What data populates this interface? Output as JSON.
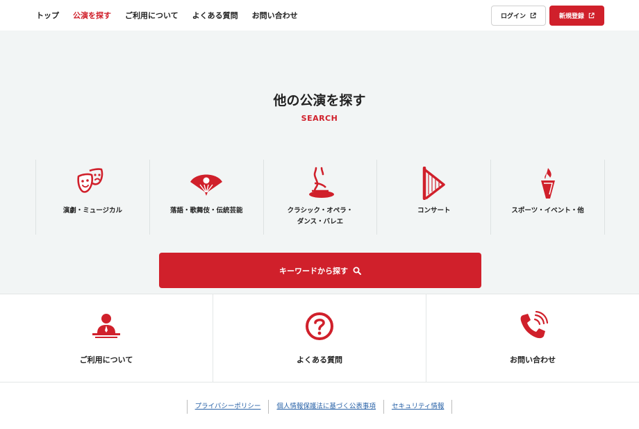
{
  "nav": {
    "items": [
      {
        "label": "トップ",
        "active": false
      },
      {
        "label": "公演を探す",
        "active": true
      },
      {
        "label": "ご利用について",
        "active": false
      },
      {
        "label": "よくある質問",
        "active": false
      },
      {
        "label": "お問い合わせ",
        "active": false
      }
    ],
    "login_label": "ログイン",
    "register_label": "新規登録"
  },
  "search": {
    "title": "他の公演を探す",
    "subtitle": "SEARCH",
    "categories": [
      {
        "label": "演劇・ミュージカル",
        "icon": "theater-masks-icon"
      },
      {
        "label": "落語・歌舞伎・伝統芸能",
        "icon": "folding-fan-icon"
      },
      {
        "label": "クラシック・オペラ・\nダンス・バレエ",
        "icon": "ballet-dancer-icon"
      },
      {
        "label": "コンサート",
        "icon": "harp-icon"
      },
      {
        "label": "スポーツ・イベント・他",
        "icon": "torch-icon"
      }
    ],
    "keyword_button": "キーワードから探す"
  },
  "info": {
    "items": [
      {
        "label": "ご利用について",
        "icon": "receptionist-icon"
      },
      {
        "label": "よくある質問",
        "icon": "question-circle-icon"
      },
      {
        "label": "お問い合わせ",
        "icon": "phone-ringing-icon"
      }
    ]
  },
  "footer": {
    "links": [
      "プライバシーポリシー",
      "個人情報保護法に基づく公表事項",
      "セキュリティ情報"
    ]
  },
  "colors": {
    "accent": "#d0202b",
    "background": "#f2f5f5",
    "link": "#2a63a8"
  }
}
